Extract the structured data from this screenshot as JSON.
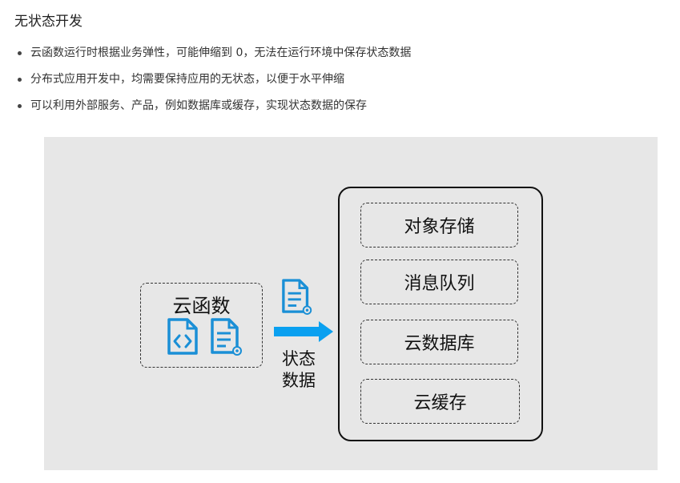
{
  "heading": "无状态开发",
  "bullets": [
    "云函数运行时根据业务弹性，可能伸缩到 0，无法在运行环境中保存状态数据",
    "分布式应用开发中，均需要保持应用的无状态，以便于水平伸缩",
    "可以利用外部服务、产品，例如数据库或缓存，实现状态数据的保存"
  ],
  "diagram": {
    "function_label": "云函数",
    "state_label_line1": "状态",
    "state_label_line2": "数据",
    "storage_items": [
      "对象存储",
      "消息队列",
      "云数据库",
      "云缓存"
    ],
    "icons": [
      "code-file-icon",
      "config-file-icon",
      "arrow-right-icon"
    ],
    "colors": {
      "icon_blue": "#1a8fd6",
      "arrow_blue": "#0aa0f0",
      "panel_bg": "#e7e7e7"
    }
  }
}
